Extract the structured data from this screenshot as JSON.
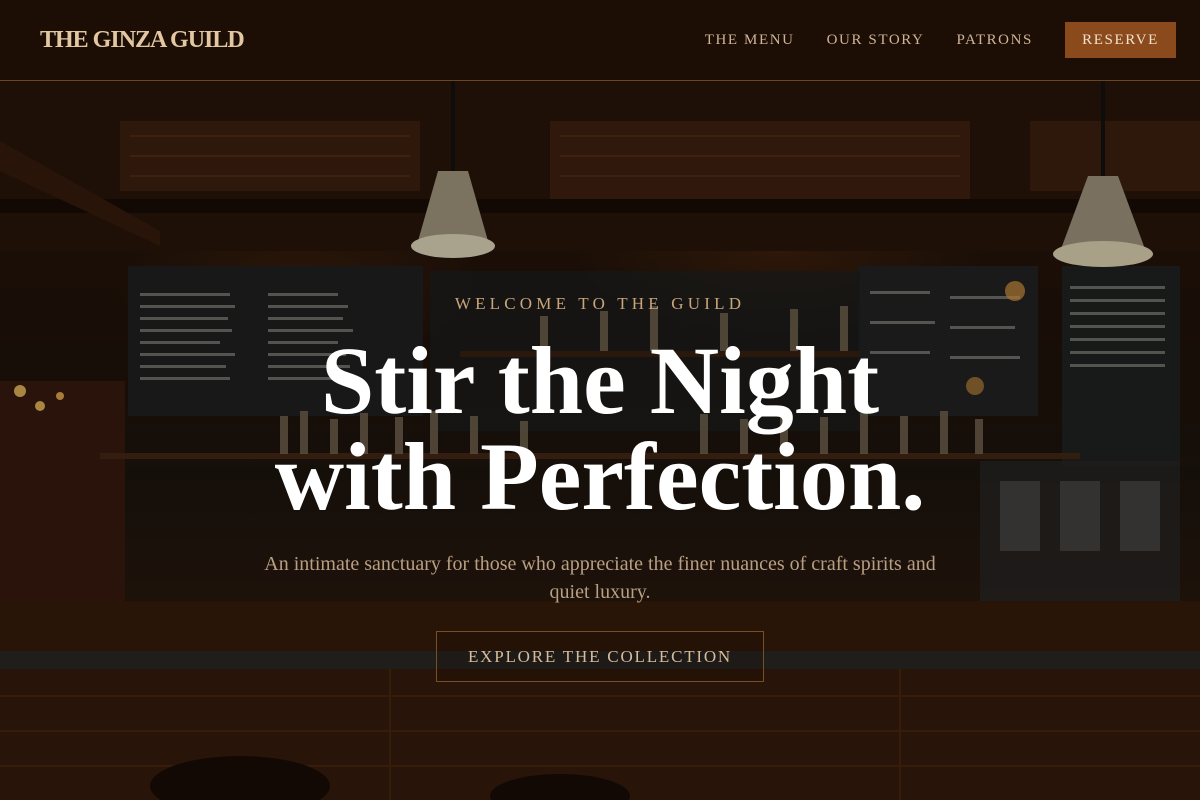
{
  "nav": {
    "brand": "THE GINZA GUILD",
    "links": [
      "THE MENU",
      "OUR STORY",
      "PATRONS"
    ],
    "reserve_label": "RESERVE"
  },
  "hero": {
    "eyebrow": "WELCOME TO THE GUILD",
    "headline_line1": "Stir the Night",
    "headline_line2": "with Perfection.",
    "subtext": "An intimate sanctuary for those who appreciate the finer nuances of craft spirits and quiet luxury.",
    "cta_label": "EXPLORE THE COLLECTION",
    "background_image": "bar-interior-photo"
  },
  "colors": {
    "nav_bg": "#1c0e05",
    "accent": "#8a4a1c",
    "brand_text": "#e2c7a2",
    "eyebrow": "#c9a57a",
    "headline": "#ffffff"
  }
}
